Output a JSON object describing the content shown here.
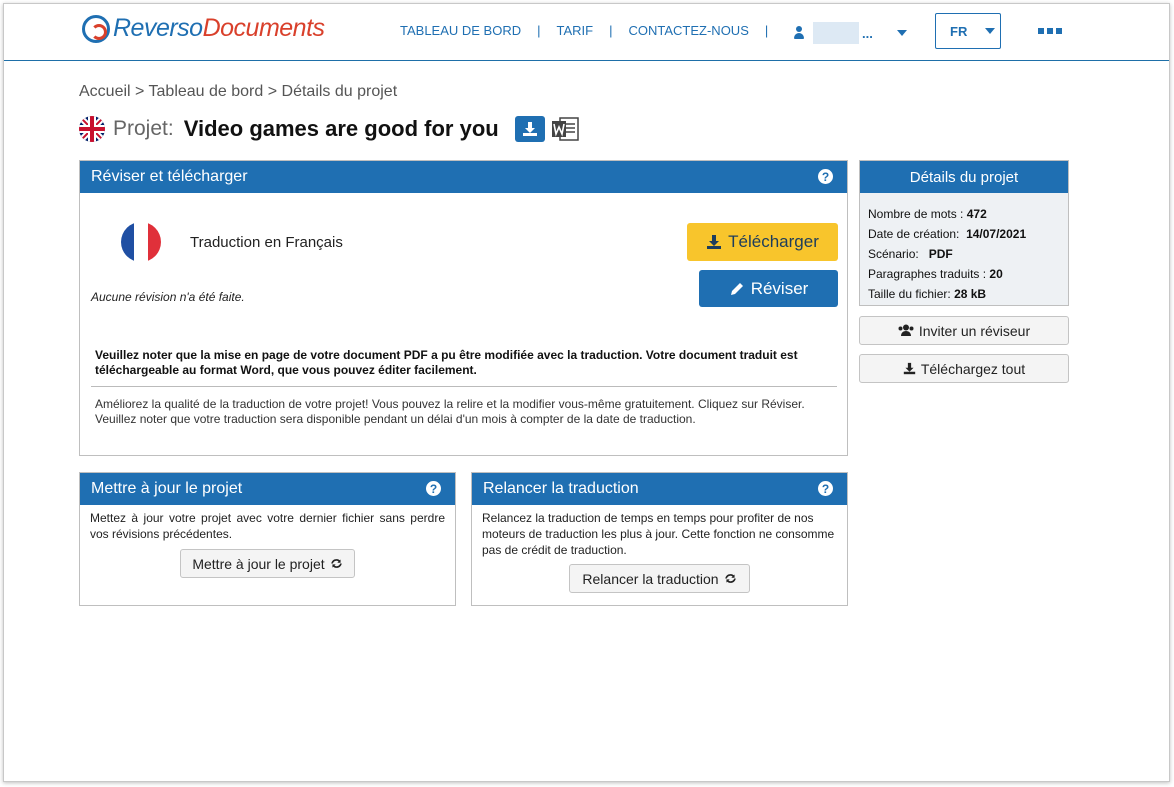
{
  "brand": {
    "part1": "Reverso",
    "part2": "Documents"
  },
  "nav": {
    "items": [
      "TABLEAU DE BORD",
      "TARIF",
      "CONTACTEZ-NOUS"
    ],
    "separator": "|"
  },
  "user": {
    "ellipsis": "..."
  },
  "language": {
    "selected": "FR"
  },
  "breadcrumb": "Accueil > Tableau de bord > Détails du projet",
  "project": {
    "label": "Projet:",
    "name": "Video games are good for you"
  },
  "main_panel": {
    "title": "Réviser et télécharger",
    "help": "?",
    "translation_label": "Traduction en Français",
    "download_label": "Télécharger",
    "revise_label": "Réviser",
    "no_revision": "Aucune révision n'a été faite.",
    "note_bold": "Veuillez noter que la mise en page de votre document PDF a pu être modifiée avec la traduction. Votre document traduit est téléchargeable au format Word, que vous pouvez éditer facilement.",
    "note_line1": "Améliorez la qualité de la traduction de votre projet! Vous pouvez la relire et la modifier vous-même gratuitement. Cliquez sur Réviser.",
    "note_line2": "Veuillez noter que votre traduction sera disponible pendant un délai d'un mois à compter de la date de traduction."
  },
  "details": {
    "title": "Détails du projet",
    "rows": [
      {
        "label": "Nombre de mots :",
        "value": "472"
      },
      {
        "label": "Date de création:",
        "value": "14/07/2021"
      },
      {
        "label": "Scénario:",
        "value": "PDF"
      },
      {
        "label": "Paragraphes traduits :",
        "value": "20"
      },
      {
        "label": "Taille du fichier:",
        "value": "28 kB"
      }
    ],
    "invite_label": "Inviter un réviseur",
    "download_all_label": "Téléchargez tout"
  },
  "update_panel": {
    "title": "Mettre à jour le projet",
    "help": "?",
    "body": "Mettez à jour votre projet avec votre dernier fichier sans perdre vos révisions précédentes.",
    "button": "Mettre à jour le projet"
  },
  "relaunch_panel": {
    "title": "Relancer la traduction",
    "help": "?",
    "body": "Relancez la traduction de temps en temps pour profiter de nos moteurs de traduction les plus à jour. Cette fonction ne consomme pas de crédit de traduction.",
    "button": "Relancer la traduction"
  },
  "colors": {
    "primary": "#1f6fb2",
    "accent": "#f8c52c",
    "brand_red": "#d9402b"
  },
  "icons": [
    "reverso-logo-icon",
    "user-icon",
    "chevron-down-icon",
    "more-icon",
    "uk-flag-icon",
    "download-icon",
    "word-icon",
    "help-icon",
    "fr-flag-icon",
    "pencil-icon",
    "users-icon",
    "refresh-icon"
  ]
}
